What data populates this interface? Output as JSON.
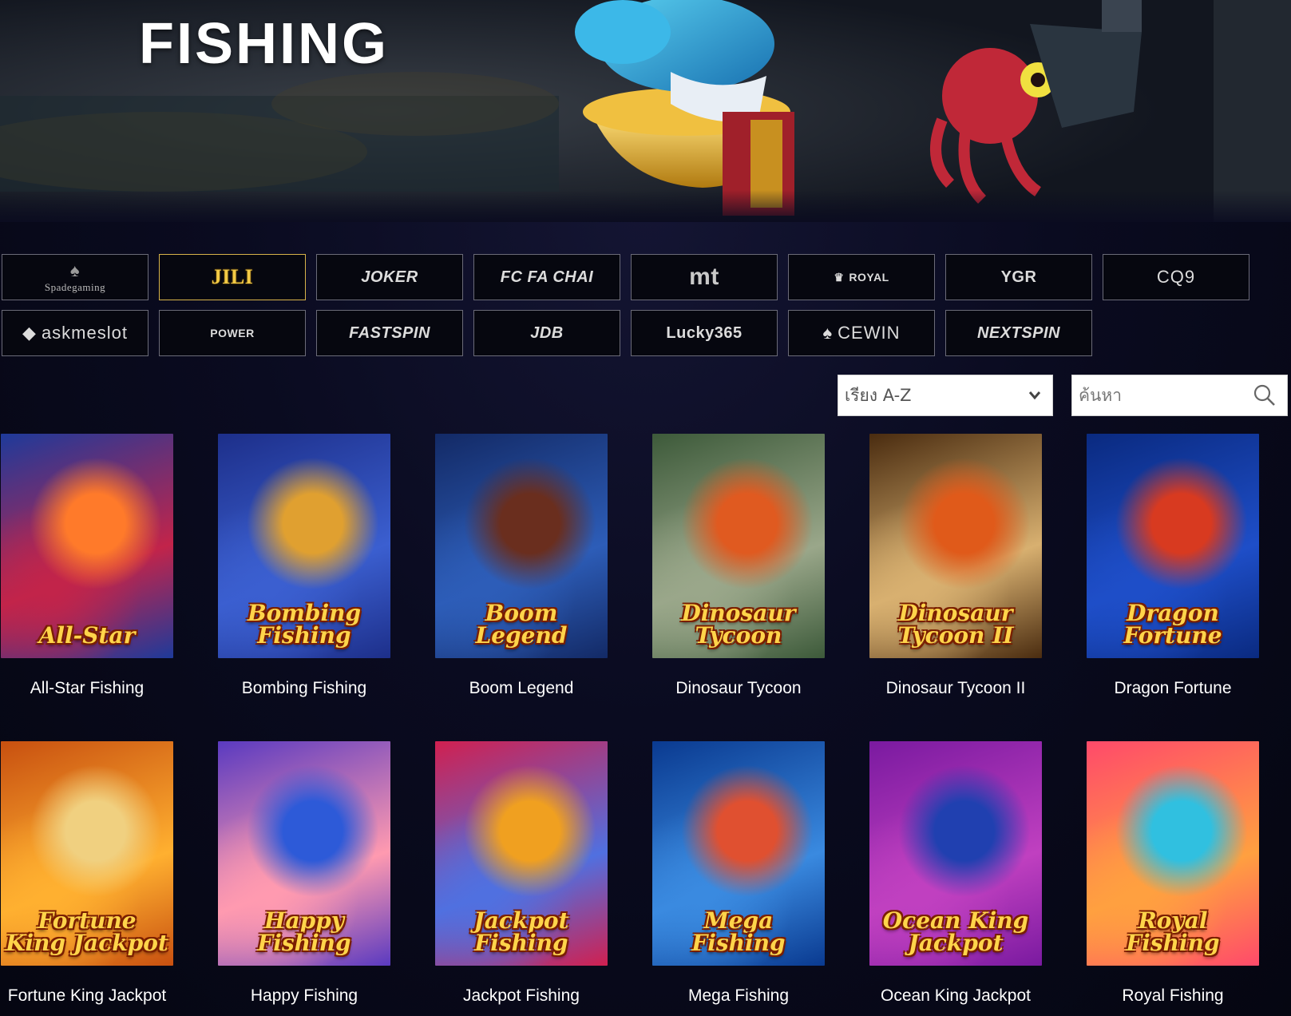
{
  "hero": {
    "title": "FISHING"
  },
  "providers": [
    {
      "id": "spadegaming",
      "label": "Spadegaming",
      "style": "serif",
      "icon": "spade-icon",
      "active": false
    },
    {
      "id": "jili",
      "label": "JILI",
      "style": "gold",
      "icon": "",
      "active": true
    },
    {
      "id": "joker",
      "label": "JOKER",
      "style": "italic",
      "icon": "",
      "active": false
    },
    {
      "id": "fachai",
      "label": "FC FA CHAI",
      "style": "italic",
      "icon": "",
      "active": false
    },
    {
      "id": "mt",
      "label": "mt",
      "style": "big",
      "icon": "",
      "active": false
    },
    {
      "id": "royal",
      "label": "ROYAL",
      "style": "small",
      "icon": "crown-icon",
      "active": false
    },
    {
      "id": "ygr",
      "label": "YGR",
      "style": "plain",
      "icon": "",
      "active": false
    },
    {
      "id": "cq9",
      "label": "CQ9",
      "style": "thin",
      "icon": "",
      "active": false
    },
    {
      "id": "askmeslot",
      "label": "askmeslot",
      "style": "thin",
      "icon": "diamond-icon",
      "active": false
    },
    {
      "id": "power",
      "label": "POWER",
      "style": "small",
      "icon": "",
      "active": false
    },
    {
      "id": "fastspin",
      "label": "FASTSPIN",
      "style": "italic",
      "icon": "",
      "active": false
    },
    {
      "id": "jdb",
      "label": "JDB",
      "style": "italic",
      "icon": "",
      "active": false
    },
    {
      "id": "lucky365",
      "label": "Lucky365",
      "style": "plain",
      "icon": "",
      "active": false
    },
    {
      "id": "cewin",
      "label": "CEWIN",
      "style": "thin",
      "icon": "spade-icon",
      "active": false
    },
    {
      "id": "nextspin",
      "label": "NEXTSPIN",
      "style": "italic",
      "icon": "",
      "active": false
    }
  ],
  "filters": {
    "sort_value": "เรียง A-Z",
    "search_placeholder": "ค้นหา"
  },
  "games": [
    {
      "name": "All-Star Fishing",
      "art_text": "All-Star",
      "colors": [
        "#1e3a9a",
        "#c2244a",
        "#ff7a2a"
      ]
    },
    {
      "name": "Bombing Fishing",
      "art_text": "Bombing Fishing",
      "colors": [
        "#1d2f8a",
        "#3b5fd0",
        "#e0a030"
      ]
    },
    {
      "name": "Boom Legend",
      "art_text": "Boom Legend",
      "colors": [
        "#132a66",
        "#2d5db8",
        "#6a2e1e"
      ]
    },
    {
      "name": "Dinosaur Tycoon",
      "art_text": "Dinosaur Tycoon",
      "colors": [
        "#3d5a3a",
        "#9aa78a",
        "#e05a20"
      ]
    },
    {
      "name": "Dinosaur Tycoon II",
      "art_text": "Dinosaur Tycoon II",
      "colors": [
        "#4a2c10",
        "#d8b070",
        "#e05a1a"
      ]
    },
    {
      "name": "Dragon Fortune",
      "art_text": "Dragon Fortune",
      "colors": [
        "#0a2a80",
        "#1e4ec8",
        "#d83a20"
      ]
    },
    {
      "name": "Fortune King Jackpot",
      "art_text": "Fortune King Jackpot",
      "colors": [
        "#c85010",
        "#ffb030",
        "#f0d080"
      ]
    },
    {
      "name": "Happy Fishing",
      "art_text": "Happy Fishing",
      "colors": [
        "#5a3ac0",
        "#ff9ab0",
        "#2d5ad8"
      ]
    },
    {
      "name": "Jackpot Fishing",
      "art_text": "Jackpot Fishing",
      "colors": [
        "#d02050",
        "#5070e0",
        "#f0a020"
      ]
    },
    {
      "name": "Mega Fishing",
      "art_text": "Mega Fishing",
      "colors": [
        "#0a3a90",
        "#3a8ae0",
        "#e05030"
      ]
    },
    {
      "name": "Ocean King Jackpot",
      "art_text": "Ocean King Jackpot",
      "colors": [
        "#7a1aa0",
        "#c040c0",
        "#2040b0"
      ]
    },
    {
      "name": "Royal Fishing",
      "art_text": "Royal Fishing",
      "colors": [
        "#ff4a6a",
        "#ffa040",
        "#30c0e0"
      ]
    }
  ]
}
